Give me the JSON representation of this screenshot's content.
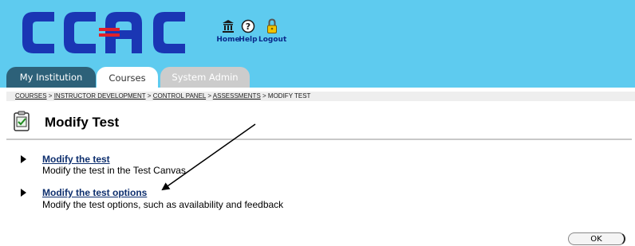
{
  "header": {
    "logo_text": "CCAC",
    "colors": {
      "background": "#5ecbef",
      "logo_blue": "#1a36b4",
      "logo_red": "#e0202a"
    },
    "top_links": [
      {
        "label": "Home",
        "icon": "institution-icon"
      },
      {
        "label": "Help",
        "icon": "help-icon"
      },
      {
        "label": "Logout",
        "icon": "padlock-icon"
      }
    ]
  },
  "tabs": [
    {
      "label": "My Institution",
      "state": "normal"
    },
    {
      "label": "Courses",
      "state": "active"
    },
    {
      "label": "System Admin",
      "state": "disabled"
    }
  ],
  "breadcrumb": {
    "items": [
      "COURSES",
      "INSTRUCTOR DEVELOPMENT",
      "CONTROL PANEL",
      "ASSESSMENTS"
    ],
    "current": "MODIFY TEST",
    "separator": ">"
  },
  "page": {
    "title": "Modify Test",
    "title_icon": "checklist-icon"
  },
  "items": [
    {
      "link": "Modify the test",
      "description": "Modify the test in the Test Canvas"
    },
    {
      "link": "Modify the test options",
      "description": "Modify the test options, such as availability and feedback"
    }
  ],
  "footer": {
    "ok_label": "OK"
  }
}
